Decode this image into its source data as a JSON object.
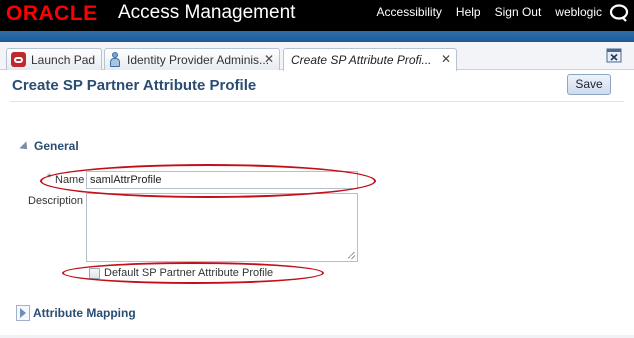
{
  "header": {
    "logo": "ORACLE",
    "app_title": "Access Management",
    "links": [
      "Accessibility",
      "Help",
      "Sign Out"
    ],
    "user": "weblogic",
    "icon": "search-ring-icon"
  },
  "tabs": [
    {
      "label": "Launch Pad",
      "icon": "launch-pad-icon",
      "active": false
    },
    {
      "label": "Identity Provider Adminis...",
      "icon": "identity-provider-icon",
      "active": false
    },
    {
      "label": "Create SP Attribute Profi...",
      "active": true
    }
  ],
  "page": {
    "title": "Create SP Partner Attribute Profile",
    "save_label": "Save"
  },
  "general": {
    "section_label": "General",
    "required_marker": "*",
    "name_label": "Name",
    "name_value": "samlAttrProfile",
    "description_label": "Description",
    "description_value": "",
    "checkbox_label": "Default SP Partner Attribute Profile",
    "checkbox_checked": false
  },
  "attribute_mapping": {
    "section_label": "Attribute Mapping"
  },
  "colors": {
    "header_bg": "#000000",
    "logo": "#ff0000",
    "band": "#1d5b95",
    "title": "#2a4d73",
    "annotation": "#c0101a"
  }
}
